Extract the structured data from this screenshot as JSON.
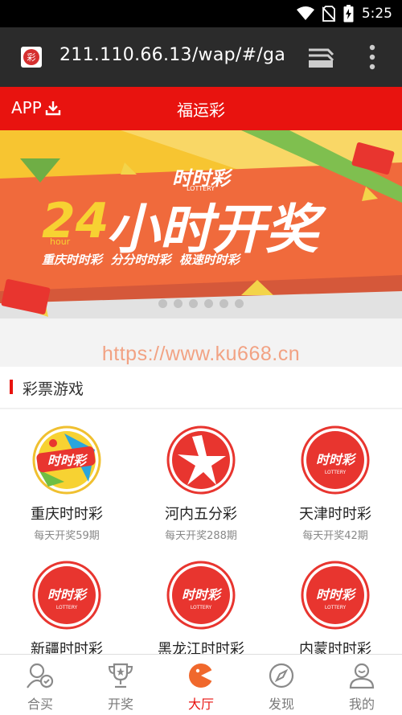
{
  "status_bar": {
    "time": "5:25"
  },
  "browser": {
    "url": "211.110.66.13/wap/#/ga",
    "favicon_glyph": "彩"
  },
  "header": {
    "app_label": "APP",
    "title": "福运彩"
  },
  "banner": {
    "logo_text": "时时彩",
    "logo_sub": "LOTTERY",
    "headline_number": "24",
    "headline_hour": "hour",
    "headline_text": "小时开奖",
    "tagline": "重庆时时彩  分分时时彩  极速时时彩",
    "slide_count": 6
  },
  "watermark": "https://www.ku668.cn",
  "section": {
    "title": "彩票游戏"
  },
  "games": [
    {
      "name": "重庆时时彩",
      "subtitle": "每天开奖59期",
      "logo": "lottery-color"
    },
    {
      "name": "河内五分彩",
      "subtitle": "每天开奖288期",
      "logo": "vietnam-star"
    },
    {
      "name": "天津时时彩",
      "subtitle": "每天开奖42期",
      "logo": "lottery-red"
    },
    {
      "name": "新疆时时彩",
      "subtitle": "",
      "logo": "lottery-red"
    },
    {
      "name": "黑龙江时时彩",
      "subtitle": "",
      "logo": "lottery-red"
    },
    {
      "name": "内蒙时时彩",
      "subtitle": "",
      "logo": "lottery-red"
    }
  ],
  "nav": [
    {
      "label": "合买",
      "icon": "group-buy-icon"
    },
    {
      "label": "开奖",
      "icon": "trophy-icon"
    },
    {
      "label": "大厅",
      "icon": "lobby-icon"
    },
    {
      "label": "发现",
      "icon": "compass-icon"
    },
    {
      "label": "我的",
      "icon": "profile-icon"
    }
  ],
  "colors": {
    "brand_red": "#e8130f",
    "banner_orange": "#f06a3c",
    "banner_yellow": "#f7c531",
    "browser_bar": "#2b2b2b"
  }
}
